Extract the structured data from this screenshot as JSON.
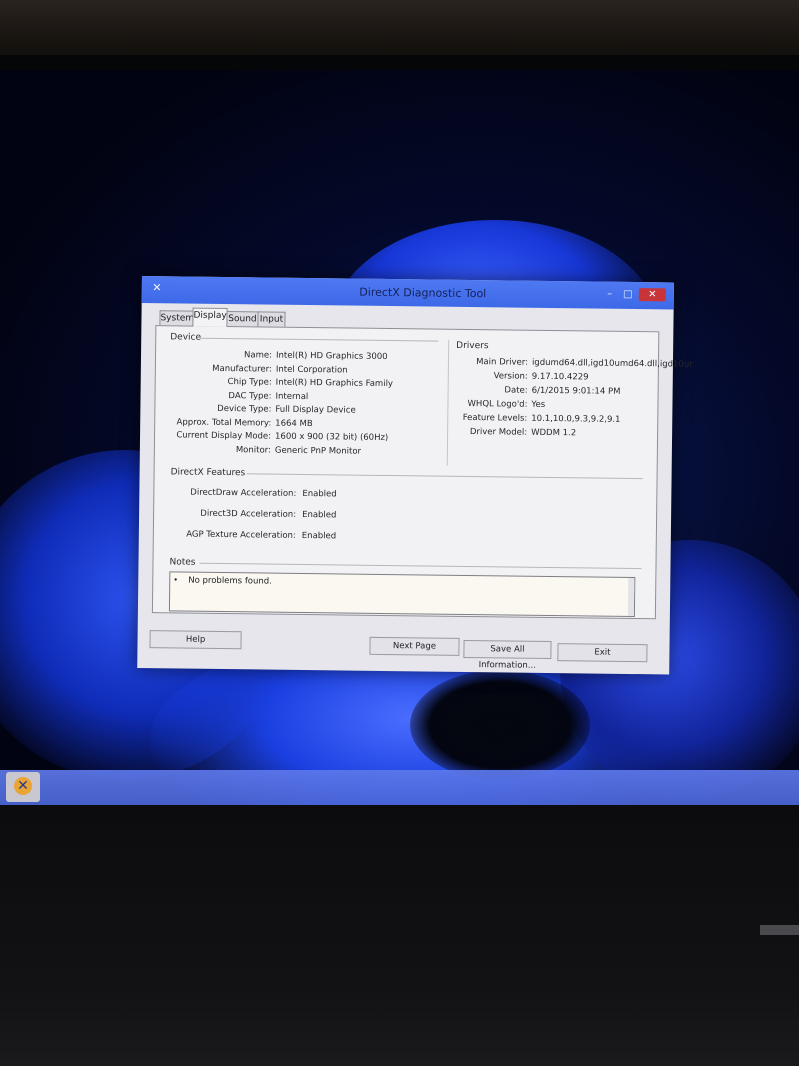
{
  "window": {
    "title": "DirectX Diagnostic Tool",
    "minimize_glyph": "–",
    "maximize_glyph": "□",
    "close_glyph": "✕"
  },
  "tabs": [
    {
      "label": "System"
    },
    {
      "label": "Display"
    },
    {
      "label": "Sound"
    },
    {
      "label": "Input"
    }
  ],
  "active_tab": "Display",
  "device": {
    "heading": "Device",
    "rows": [
      {
        "key": "Name:",
        "value": "Intel(R) HD Graphics 3000"
      },
      {
        "key": "Manufacturer:",
        "value": "Intel Corporation"
      },
      {
        "key": "Chip Type:",
        "value": "Intel(R) HD Graphics Family"
      },
      {
        "key": "DAC Type:",
        "value": "Internal"
      },
      {
        "key": "Device Type:",
        "value": "Full Display Device"
      },
      {
        "key": "Approx. Total Memory:",
        "value": "1664 MB"
      },
      {
        "key": "Current Display Mode:",
        "value": "1600 x 900 (32 bit) (60Hz)"
      },
      {
        "key": "Monitor:",
        "value": "Generic PnP Monitor"
      }
    ]
  },
  "drivers": {
    "heading": "Drivers",
    "rows": [
      {
        "key": "Main Driver:",
        "value": "igdumd64.dll,igd10umd64.dll,igd10ur"
      },
      {
        "key": "Version:",
        "value": "9.17.10.4229"
      },
      {
        "key": "Date:",
        "value": "6/1/2015 9:01:14 PM"
      },
      {
        "key": "WHQL Logo'd:",
        "value": "Yes"
      },
      {
        "key": "Feature Levels:",
        "value": "10.1,10.0,9.3,9.2,9.1"
      },
      {
        "key": "Driver Model:",
        "value": "WDDM 1.2"
      }
    ]
  },
  "directx_features": {
    "heading": "DirectX Features",
    "rows": [
      {
        "key": "DirectDraw Acceleration:",
        "value": "Enabled"
      },
      {
        "key": "Direct3D Acceleration:",
        "value": "Enabled"
      },
      {
        "key": "AGP Texture Acceleration:",
        "value": "Enabled"
      }
    ]
  },
  "notes": {
    "heading": "Notes",
    "bullet": "•",
    "items": [
      "No problems found."
    ]
  },
  "buttons": {
    "help": "Help",
    "next_page": "Next Page",
    "save_all": "Save All Information...",
    "exit": "Exit"
  },
  "taskbar": {
    "start_glyph": "✕"
  }
}
